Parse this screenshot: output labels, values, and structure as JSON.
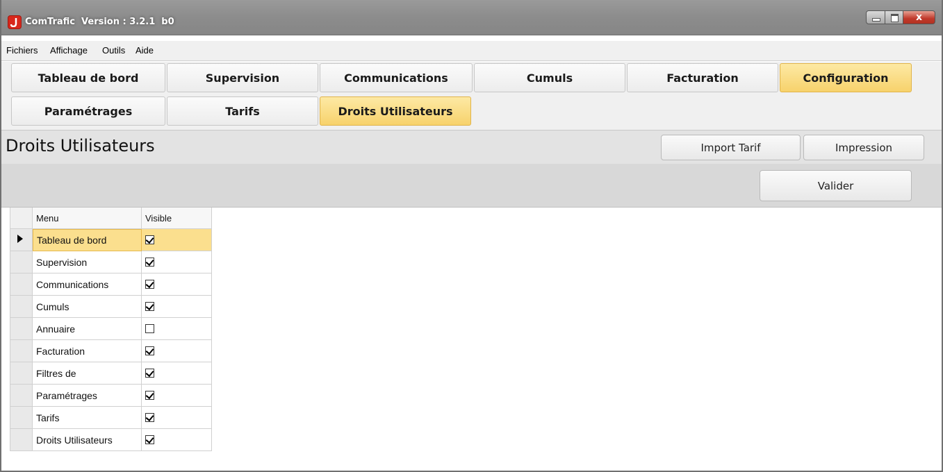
{
  "window": {
    "title": "ComTrafic  Version : 3.2.1  b0",
    "close_glyph": "x"
  },
  "menubar": {
    "items": [
      "Fichiers",
      "Affichage",
      "Outils",
      "Aide"
    ]
  },
  "main_tabs": [
    {
      "label": "Tableau de bord",
      "active": false
    },
    {
      "label": "Supervision",
      "active": false
    },
    {
      "label": "Communications",
      "active": false
    },
    {
      "label": "Cumuls",
      "active": false
    },
    {
      "label": "Facturation",
      "active": false
    },
    {
      "label": "Configuration",
      "active": true
    }
  ],
  "sub_tabs": [
    {
      "label": "Paramétrages",
      "active": false
    },
    {
      "label": "Tarifs",
      "active": false
    },
    {
      "label": "Droits Utilisateurs",
      "active": true
    }
  ],
  "header": {
    "title": "Droits Utilisateurs",
    "import_button": "Import Tarif",
    "print_button": "Impression"
  },
  "actions": {
    "validate_button": "Valider"
  },
  "grid": {
    "columns": [
      "Menu",
      "Visible"
    ],
    "selected_row": 0,
    "rows": [
      {
        "menu": "Tableau de bord",
        "visible": true
      },
      {
        "menu": "Supervision",
        "visible": true
      },
      {
        "menu": "Communications",
        "visible": true
      },
      {
        "menu": "Cumuls",
        "visible": true
      },
      {
        "menu": "Annuaire",
        "visible": false
      },
      {
        "menu": "Facturation",
        "visible": true
      },
      {
        "menu": "Filtres de",
        "visible": true
      },
      {
        "menu": "Paramétrages",
        "visible": true
      },
      {
        "menu": "Tarifs",
        "visible": true
      },
      {
        "menu": "Droits Utilisateurs",
        "visible": true
      }
    ]
  },
  "colors": {
    "active_tab": "#f7d26c",
    "selected_row": "#fbdf8e",
    "close_button": "#c0392b",
    "app_icon": "#d8271b"
  }
}
